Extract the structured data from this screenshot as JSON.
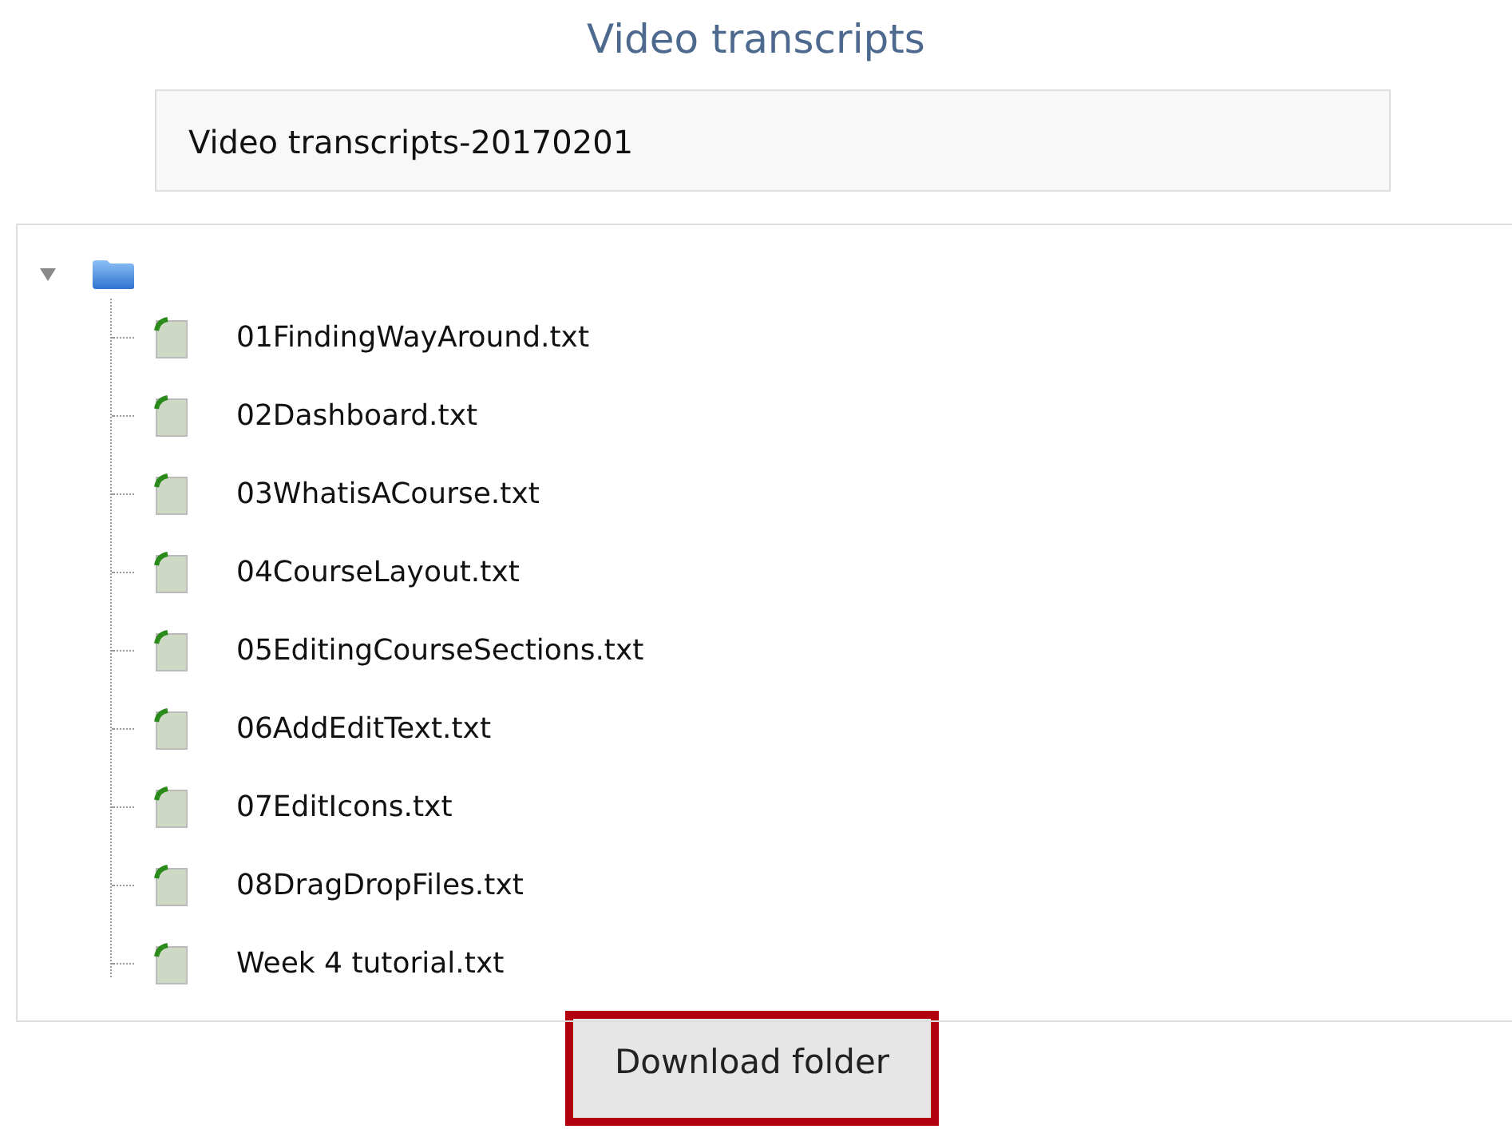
{
  "title": "Video transcripts",
  "description": "Video transcripts-20170201",
  "tree": {
    "expanded": true,
    "children": [
      {
        "name": "01FindingWayAround.txt"
      },
      {
        "name": "02Dashboard.txt"
      },
      {
        "name": "03WhatisACourse.txt"
      },
      {
        "name": "04CourseLayout.txt"
      },
      {
        "name": "05EditingCourseSections.txt"
      },
      {
        "name": "06AddEditText.txt"
      },
      {
        "name": "07EditIcons.txt"
      },
      {
        "name": "08DragDropFiles.txt"
      },
      {
        "name": "Week 4 tutorial.txt"
      }
    ]
  },
  "download_button": {
    "label": "Download folder",
    "highlighted": true
  }
}
